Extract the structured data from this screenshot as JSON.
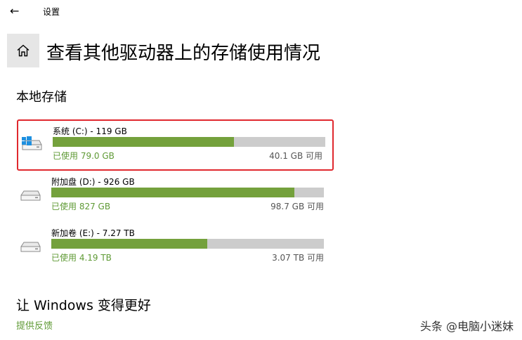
{
  "window": {
    "back_glyph": "←",
    "app_title": "设置"
  },
  "header": {
    "home_icon": "home-icon",
    "title": "查看其他驱动器上的存储使用情况"
  },
  "local_storage": {
    "heading": "本地存储",
    "drives": [
      {
        "name": "系统 (C:) - 119 GB",
        "used": "已使用 79.0 GB",
        "free": "40.1 GB 可用",
        "used_fraction": 0.664,
        "icon": "windows-drive-icon",
        "highlighted": true
      },
      {
        "name": "附加盘 (D:) - 926 GB",
        "used": "已使用 827 GB",
        "free": "98.7 GB 可用",
        "used_fraction": 0.893,
        "icon": "drive-icon",
        "highlighted": false
      },
      {
        "name": "新加卷 (E:) - 7.27 TB",
        "used": "已使用 4.19 TB",
        "free": "3.07 TB 可用",
        "used_fraction": 0.572,
        "icon": "drive-icon",
        "highlighted": false
      }
    ]
  },
  "improve": {
    "heading": "让 Windows 变得更好",
    "feedback_link": "提供反馈"
  },
  "watermark": "头条 @电脑小迷妹",
  "colors": {
    "bar_fill": "#74a13c",
    "bar_track": "#cccccc",
    "highlight_border": "#e0282e",
    "accent_text": "#5f9a35"
  }
}
